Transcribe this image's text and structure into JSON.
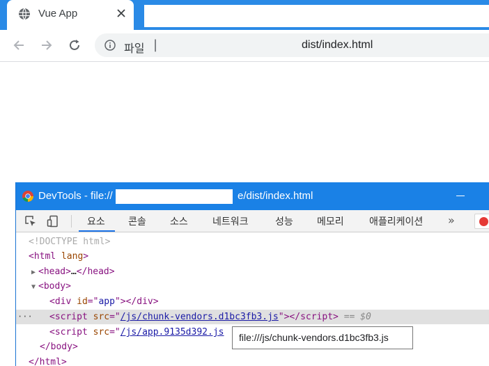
{
  "browser": {
    "tab": {
      "title": "Vue App",
      "favicon": "globe-icon",
      "close_icon": "close-icon"
    },
    "toolbar": {
      "back_icon": "arrow-left-icon",
      "forward_icon": "arrow-right-icon",
      "reload_icon": "reload-icon",
      "omnibox": {
        "info_icon": "info-icon",
        "scheme_label": "파일",
        "separator": "|",
        "path": "dist/index.html"
      }
    }
  },
  "devtools": {
    "title_prefix": "DevTools - file://",
    "title_suffix": "e/dist/index.html",
    "tabs": [
      {
        "label": "요소",
        "active": true
      },
      {
        "label": "콘솔",
        "active": false
      },
      {
        "label": "소스",
        "active": false
      },
      {
        "label": "네트워크",
        "active": false
      },
      {
        "label": "성능",
        "active": false
      },
      {
        "label": "메모리",
        "active": false
      },
      {
        "label": "애플리케이션",
        "active": false
      }
    ],
    "more_label": "»",
    "elements": {
      "doctype": "<!DOCTYPE html>",
      "html_open_tag": "html",
      "html_open_attr": "lang",
      "head_open": "head",
      "head_ellipsis": "…",
      "head_close": "head",
      "body_open": "body",
      "div_tag": "div",
      "div_attr": "id",
      "div_attr_value": "app",
      "div_close": "div",
      "script1_tag": "script",
      "script1_attr": "src",
      "script1_src": "/js/chunk-vendors.d1bc3fb3.js",
      "script1_close": "script",
      "script1_marker": "== $0",
      "script2_tag": "script",
      "script2_attr": "src",
      "script2_src": "/js/app.9135d392.js",
      "body_close": "body",
      "html_close": "html",
      "row_dots": "···"
    },
    "tooltip": "file:///js/chunk-vendors.d1bc3fb3.js"
  },
  "colors": {
    "tabstrip": "#2a8ae6",
    "devtools_titlebar": "#1a81e6",
    "tag": "#881280",
    "attr": "#994500",
    "value": "#1a1aa6"
  }
}
